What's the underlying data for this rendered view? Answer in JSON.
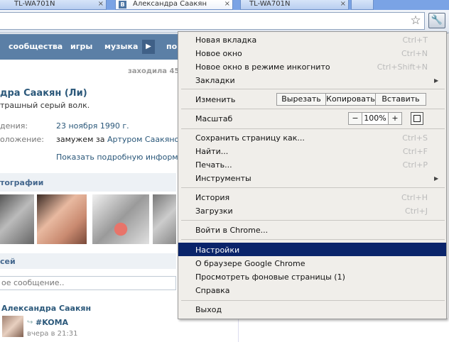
{
  "tabs": [
    {
      "label": "TL-WA701N",
      "close": "×"
    },
    {
      "label": "Александра Саакян",
      "favicon": "В",
      "close": "×"
    },
    {
      "label": "TL-WA701N",
      "close": "×"
    }
  ],
  "vk": {
    "nav": [
      "сообщества",
      "игры",
      "музыка",
      "по"
    ],
    "online": "заходила 45",
    "profile_name": "дра Саакян (Ли)",
    "status": "трашный серый волк.",
    "info": [
      {
        "label": "дения:",
        "value": "23 ноября 1990 г."
      },
      {
        "label": "оложение:",
        "value_prefix": "замужем за",
        "value_link": "Артуром Саакяном"
      }
    ],
    "show_info": "Показать подробную информацию",
    "photos_title": "тографии",
    "wall_title": "сей",
    "message_placeholder": "ое сообщение..",
    "post": {
      "author": "Александра Саакян",
      "tag": "#KOMA",
      "time": "вчера в 21:31"
    }
  },
  "menu": {
    "items": [
      {
        "label": "Новая вкладка",
        "shortcut": "Ctrl+T"
      },
      {
        "label": "Новое окно",
        "shortcut": "Ctrl+N"
      },
      {
        "label": "Новое окно в режиме инкогнито",
        "shortcut": "Ctrl+Shift+N"
      },
      {
        "label": "Закладки"
      }
    ],
    "edit": {
      "label": "Изменить",
      "cut": "Вырезать",
      "copy": "Копировать",
      "paste": "Вставить"
    },
    "zoom": {
      "label": "Масштаб",
      "minus": "−",
      "value": "100%",
      "plus": "+"
    },
    "items2": [
      {
        "label": "Сохранить страницу как...",
        "shortcut": "Ctrl+S"
      },
      {
        "label": "Найти...",
        "shortcut": "Ctrl+F"
      },
      {
        "label": "Печать...",
        "shortcut": "Ctrl+P"
      },
      {
        "label": "Инструменты"
      }
    ],
    "items3": [
      {
        "label": "История",
        "shortcut": "Ctrl+H"
      },
      {
        "label": "Загрузки",
        "shortcut": "Ctrl+J"
      }
    ],
    "signin": "Войти в Chrome...",
    "items4": [
      {
        "label": "Настройки"
      },
      {
        "label": "О браузере Google Chrome"
      },
      {
        "label": "Просмотреть фоновые страницы (1)"
      },
      {
        "label": "Справка"
      }
    ],
    "exit": "Выход"
  }
}
